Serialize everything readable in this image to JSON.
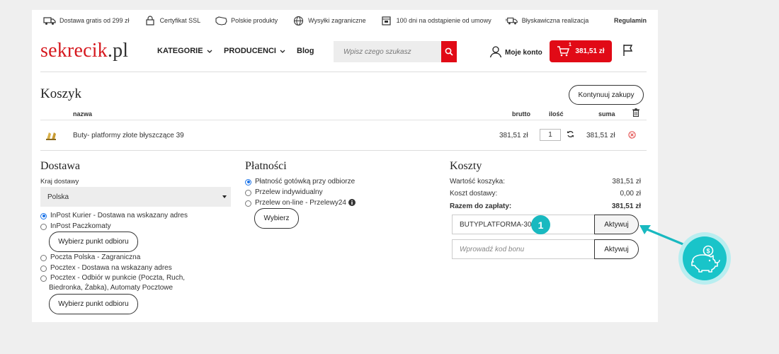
{
  "topbar": {
    "items": [
      {
        "label": "Dostawa gratis od 299 zł",
        "icon": "delivery-icon"
      },
      {
        "label": "Certyfikat SSL",
        "icon": "ssl-icon"
      },
      {
        "label": "Polskie produkty",
        "icon": "poland-map-icon"
      },
      {
        "label": "Wysyłki zagraniczne",
        "icon": "globe-icon"
      },
      {
        "label": "100 dni na odstąpienie od umowy",
        "icon": "calendar-icon"
      },
      {
        "label": "Błyskawiczna realizacja",
        "icon": "fast-truck-icon"
      }
    ],
    "regulamin": "Regulamin"
  },
  "header": {
    "logo_main": "sekrecik",
    "logo_tld": ".pl",
    "nav": [
      "KATEGORIE",
      "PRODUCENCI",
      "Blog"
    ],
    "search_placeholder": "Wpisz czego szukasz",
    "account_label": "Moje konto",
    "cart_total": "381,51 zł",
    "cart_badge": "1"
  },
  "cart": {
    "title": "Koszyk",
    "continue_label": "Kontynuuj zakupy",
    "columns": {
      "name": "nazwa",
      "price": "brutto",
      "qty": "ilość",
      "sum": "suma"
    },
    "rows": [
      {
        "name": "Buty- platformy złote błyszczące 39",
        "price": "381,51 zł",
        "qty": "1",
        "sum": "381,51 zł"
      }
    ]
  },
  "delivery": {
    "title": "Dostawa",
    "country_label": "Kraj dostawy",
    "country_value": "Polska",
    "options": [
      "InPost Kurier - Dostawa na wskazany adres",
      "InPost Paczkomaty",
      "Poczta Polska - Zagraniczna",
      "Pocztex - Dostawa na wskazany adres",
      "Pocztex - Odbiór w punkcie (Poczta, Ruch,",
      "Biedronka, Żabka), Automaty Pocztowe"
    ],
    "pickup_label": "Wybierz punkt odbioru"
  },
  "payment": {
    "title": "Płatności",
    "options": [
      "Płatność gotówką przy odbiorze",
      "Przelew indywidualny",
      "Przelew on-line - Przelewy24"
    ],
    "choose_label": "Wybierz"
  },
  "costs": {
    "title": "Koszty",
    "cart_value_label": "Wartość koszyka:",
    "cart_value": "381,51 zł",
    "shipping_label": "Koszt dostawy:",
    "shipping_value": "0,00 zł",
    "total_label": "Razem do zapłaty:",
    "total_value": "381,51 zł",
    "promo_code": "BUTYPLATFORMA-30",
    "voucher_placeholder": "Wprowadź kod bonu",
    "activate_label": "Aktywuj"
  },
  "annotation": {
    "step": "1"
  },
  "colors": {
    "brand_red": "#e10a16",
    "accent_teal": "#19b9c0"
  }
}
